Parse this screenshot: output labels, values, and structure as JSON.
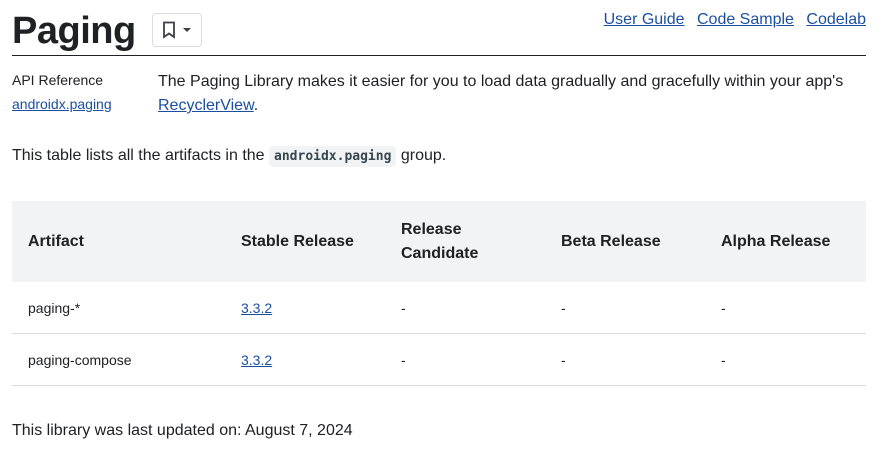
{
  "header": {
    "title": "Paging",
    "links": [
      "User Guide",
      "Code Sample",
      "Codelab"
    ]
  },
  "sidebar": {
    "label": "API Reference",
    "link": "androidx.paging"
  },
  "intro": {
    "text": "The Paging Library makes it easier for you to load data gradually and gracefully within your app's",
    "link": "RecyclerView",
    "suffix": "."
  },
  "lead": {
    "before": "This table lists all the artifacts in the",
    "code": "androidx.paging",
    "after": "group."
  },
  "table": {
    "headers": [
      "Artifact",
      "Stable Release",
      "Release Candidate",
      "Beta Release",
      "Alpha Release"
    ],
    "rows": [
      [
        "paging-*",
        "3.3.2",
        "-",
        "-",
        "-"
      ],
      [
        "paging-compose",
        "3.3.2",
        "-",
        "-",
        "-"
      ]
    ]
  },
  "footer": {
    "text": "This library was last updated on: August 7, 2024"
  },
  "colors": {
    "link": "#1a4fa0",
    "header_bg": "#f1f3f4",
    "text": "#202124"
  }
}
